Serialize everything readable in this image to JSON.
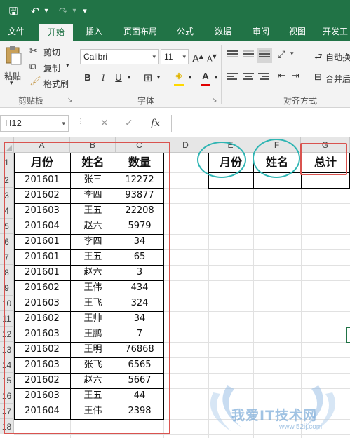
{
  "quick_access": {
    "save": "🖫",
    "undo": "↶",
    "redo": "↷",
    "customize": "▾"
  },
  "tabs": [
    "文件",
    "开始",
    "插入",
    "页面布局",
    "公式",
    "数据",
    "审阅",
    "视图",
    "开发工"
  ],
  "active_tab": "开始",
  "clipboard": {
    "paste": "粘贴",
    "cut": "剪切",
    "copy": "复制",
    "format_painter": "格式刷",
    "group_label": "剪贴板"
  },
  "font": {
    "name": "Calibri",
    "size": "11",
    "grow": "A",
    "shrink": "A",
    "bold": "B",
    "italic": "I",
    "underline": "U",
    "border": "⊞",
    "fill": "◈",
    "color": "A",
    "group_label": "字体"
  },
  "alignment": {
    "wrap": "自动换",
    "merge": "合并后",
    "group_label": "对齐方式"
  },
  "formula_bar": {
    "name_box": "H12",
    "cancel": "✕",
    "enter": "✓",
    "fx": "fx",
    "value": ""
  },
  "columns": [
    "A",
    "B",
    "C",
    "D",
    "E",
    "F",
    "G"
  ],
  "rows": [
    "1",
    "2",
    "3",
    "4",
    "5",
    "6",
    "7",
    "8",
    "9",
    "10",
    "11",
    "12",
    "13",
    "14",
    "15",
    "16",
    "17",
    "18"
  ],
  "table": {
    "headers": [
      "月份",
      "姓名",
      "数量"
    ],
    "rows": [
      [
        "201601",
        "张三",
        "12272"
      ],
      [
        "201602",
        "李四",
        "93877"
      ],
      [
        "201603",
        "王五",
        "22208"
      ],
      [
        "201604",
        "赵六",
        "5979"
      ],
      [
        "201601",
        "李四",
        "34"
      ],
      [
        "201601",
        "王五",
        "65"
      ],
      [
        "201601",
        "赵六",
        "3"
      ],
      [
        "201602",
        "王伟",
        "434"
      ],
      [
        "201603",
        "王飞",
        "324"
      ],
      [
        "201602",
        "王帅",
        "34"
      ],
      [
        "201603",
        "王鹏",
        "7"
      ],
      [
        "201602",
        "王明",
        "76868"
      ],
      [
        "201603",
        "张飞",
        "6565"
      ],
      [
        "201602",
        "赵六",
        "5667"
      ],
      [
        "201603",
        "王五",
        "44"
      ],
      [
        "201604",
        "王伟",
        "2398"
      ]
    ]
  },
  "summary_headers": [
    "月份",
    "姓名",
    "总计"
  ],
  "watermark": {
    "text": "我爱IT技术网",
    "url": "www.52ij.com"
  },
  "colors": {
    "excel_green": "#217346",
    "annot_red": "#d9534f",
    "annot_teal": "#2fb5b3"
  }
}
